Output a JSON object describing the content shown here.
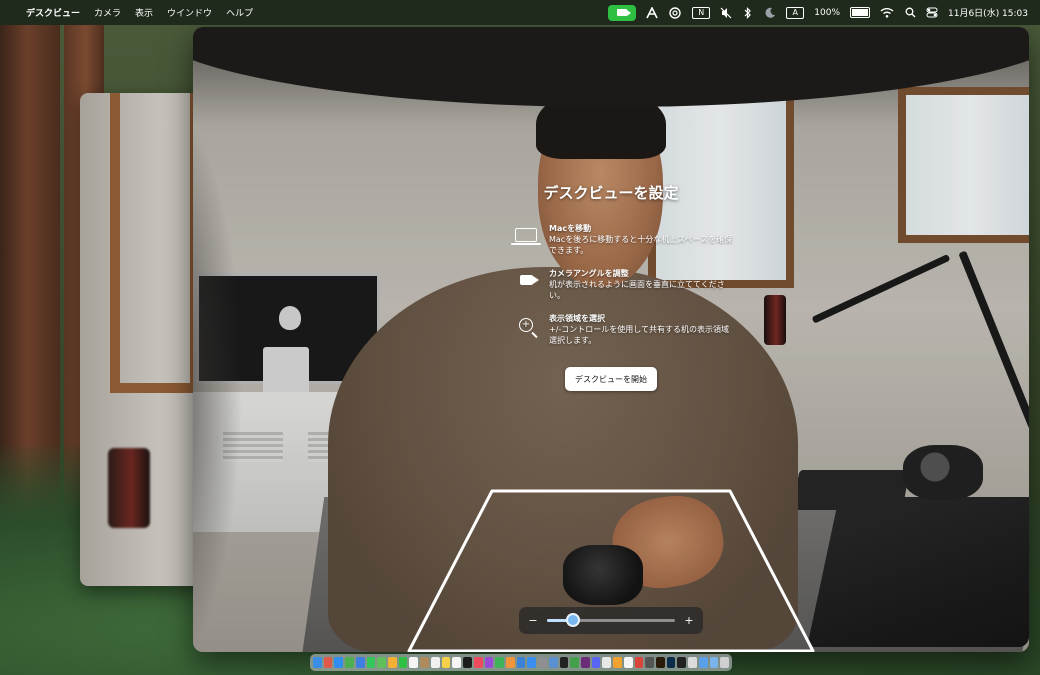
{
  "menubar": {
    "apple_symbol": "",
    "app_name": "デスクビュー",
    "menus": [
      "カメラ",
      "表示",
      "ウインドウ",
      "ヘルプ"
    ],
    "notion_label": "N",
    "input_label": "A",
    "battery_label": "100%",
    "clock": "11月6日(水) 15:03"
  },
  "overlay": {
    "title": "デスクビューを設定",
    "steps": [
      {
        "icon": "laptop-icon",
        "title": "Macを移動",
        "text": "Macを後ろに移動すると十分な机上スペースを確保できます。"
      },
      {
        "icon": "video-icon",
        "title": "カメラアングルを調整",
        "text": "机が表示されるように画面を垂直に立ててください。"
      },
      {
        "icon": "zoom-icon",
        "title": "表示領域を選択",
        "text": "+/-コントロールを使用して共有する机の表示領域選択します。"
      }
    ],
    "start_button": "デスクビューを開始",
    "zoom": {
      "minus": "−",
      "plus": "+",
      "level": 0.2
    }
  },
  "colors": {
    "menubar_camera": "#2fbf43",
    "region_outline": "#ffffff",
    "slider_thumb": "#7ab7ee"
  },
  "dock": {
    "apps": [
      {
        "name": "finder-icon",
        "color": "#3a8ee6"
      },
      {
        "name": "launchpad-icon",
        "color": "#e05a4b"
      },
      {
        "name": "safari-icon",
        "color": "#2f8ef0"
      },
      {
        "name": "chrome-icon",
        "color": "#4caf50"
      },
      {
        "name": "mail-icon",
        "color": "#3d7fe0"
      },
      {
        "name": "messages-icon",
        "color": "#35c759"
      },
      {
        "name": "maps-icon",
        "color": "#5fbf5a"
      },
      {
        "name": "photos-icon",
        "color": "#f2b134"
      },
      {
        "name": "facetime-icon",
        "color": "#2fbf43"
      },
      {
        "name": "calendar-icon",
        "color": "#f5f5f5"
      },
      {
        "name": "contacts-icon",
        "color": "#b08a5a"
      },
      {
        "name": "reminders-icon",
        "color": "#f0f0f0"
      },
      {
        "name": "notes-icon",
        "color": "#f7d04a"
      },
      {
        "name": "freeform-icon",
        "color": "#f5f5f5"
      },
      {
        "name": "tv-icon",
        "color": "#1c1c1c"
      },
      {
        "name": "music-icon",
        "color": "#f04a5f"
      },
      {
        "name": "podcasts-icon",
        "color": "#9b4ad8"
      },
      {
        "name": "numbers-icon",
        "color": "#3fb35a"
      },
      {
        "name": "pages-icon",
        "color": "#f0953a"
      },
      {
        "name": "keynote-icon",
        "color": "#3b82d9"
      },
      {
        "name": "appstore-icon",
        "color": "#3a8ef0"
      },
      {
        "name": "settings-icon",
        "color": "#8e8e93"
      },
      {
        "name": "preview-icon",
        "color": "#5a8fd0"
      },
      {
        "name": "terminal-icon",
        "color": "#222222"
      },
      {
        "name": "chrome2-icon",
        "color": "#45a04e"
      },
      {
        "name": "slack-icon",
        "color": "#6b2d78"
      },
      {
        "name": "discord-icon",
        "color": "#5865f2"
      },
      {
        "name": "screenshot-icon",
        "color": "#e8e8e8"
      },
      {
        "name": "butterfly-icon",
        "color": "#f2a22e"
      },
      {
        "name": "notion-dock-icon",
        "color": "#f5f5f5"
      },
      {
        "name": "pdf-icon",
        "color": "#d9453b"
      },
      {
        "name": "davinci-icon",
        "color": "#555555"
      },
      {
        "name": "illustrator-icon",
        "color": "#2b1b0a"
      },
      {
        "name": "photoshop-icon",
        "color": "#0d2b4a"
      },
      {
        "name": "camera-app-icon",
        "color": "#222222"
      },
      {
        "name": "deskview-icon",
        "color": "#dcdcdc"
      },
      {
        "name": "downloads-icon",
        "color": "#5aa0e8"
      },
      {
        "name": "folder-icon",
        "color": "#7bb3ec"
      },
      {
        "name": "trash-icon",
        "color": "#d0d0d0"
      }
    ]
  }
}
